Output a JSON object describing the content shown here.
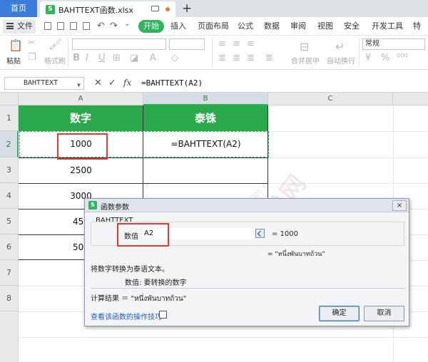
{
  "titlebar": {
    "home_tab": "首页",
    "file_tab": "BAHTTEXT函数.xlsx",
    "logo_letter": "S",
    "new_tab": "+"
  },
  "menubar": {
    "file_menu": "文件",
    "start": "开始",
    "items": [
      "插入",
      "页面布局",
      "公式",
      "数据",
      "审阅",
      "视图",
      "安全",
      "开发工具",
      "特色"
    ]
  },
  "ribbon": {
    "paste": "粘贴",
    "format_painter": "格式刷",
    "number_format": "常规",
    "merge_center": "合并居中",
    "wrap_text": "自动换行"
  },
  "formulabar": {
    "name_box": "BAHTTEXT",
    "cancel_icon": "✕",
    "confirm_icon": "✓",
    "fx": "fx",
    "formula": "=BAHTTEXT(A2)"
  },
  "grid": {
    "columns": [
      "A",
      "B",
      "C"
    ],
    "rows": [
      "1",
      "2",
      "3",
      "4",
      "5",
      "6",
      "7",
      "8"
    ],
    "header_a": "数字",
    "header_b": "泰铢",
    "a_values": [
      "1000",
      "2500",
      "3000",
      "450",
      "500"
    ],
    "b2": "=BAHTTEXT(A2)"
  },
  "dialog": {
    "logo_letter": "S",
    "title": "函数参数",
    "close": "×",
    "function_name": "BAHTTEXT",
    "arg_label": "数值",
    "arg_value": "A2",
    "arg_result": "= 1000",
    "result_line": "= \"หนึ่งพันบาทถ้วน\"",
    "description": "将数字转换为泰语文本。",
    "arg_description": "数值:  要转换的数字",
    "calc_result": "计算结果 ＝ \"หนึ่งพันบาทถ้วน\"",
    "help_link": "查看该函数的操作技巧",
    "ok": "确定",
    "cancel": "取消"
  },
  "watermark": {
    "main": "软件自学网",
    "sub": "WWW.RJZXW.COM"
  }
}
